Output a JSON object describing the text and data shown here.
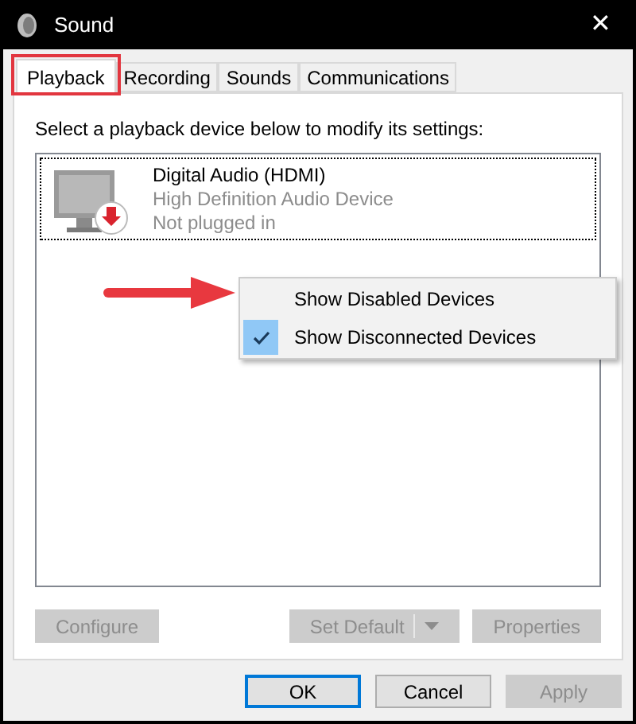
{
  "window": {
    "title": "Sound",
    "close_glyph": "✕"
  },
  "tabs": [
    {
      "label": "Playback",
      "selected": true,
      "highlighted": true
    },
    {
      "label": "Recording",
      "selected": false,
      "highlighted": false
    },
    {
      "label": "Sounds",
      "selected": false,
      "highlighted": false
    },
    {
      "label": "Communications",
      "selected": false,
      "highlighted": false
    }
  ],
  "instruction": "Select a playback device below to modify its settings:",
  "devices": [
    {
      "name": "Digital Audio (HDMI)",
      "description": "High Definition Audio Device",
      "status": "Not plugged in",
      "selected": true
    }
  ],
  "annotation_arrow": true,
  "context_menu": {
    "items": [
      {
        "label": "Show Disabled Devices",
        "checked": false
      },
      {
        "label": "Show Disconnected Devices",
        "checked": true
      }
    ]
  },
  "device_buttons": [
    {
      "label": "Configure",
      "disabled": true,
      "kind": "plain"
    },
    {
      "label": "Set Default",
      "disabled": true,
      "kind": "split"
    },
    {
      "label": "Properties",
      "disabled": true,
      "kind": "plain"
    }
  ],
  "dialog_buttons": [
    {
      "label": "OK",
      "disabled": false,
      "default": true
    },
    {
      "label": "Cancel",
      "disabled": false,
      "default": false
    },
    {
      "label": "Apply",
      "disabled": true,
      "default": false
    }
  ]
}
